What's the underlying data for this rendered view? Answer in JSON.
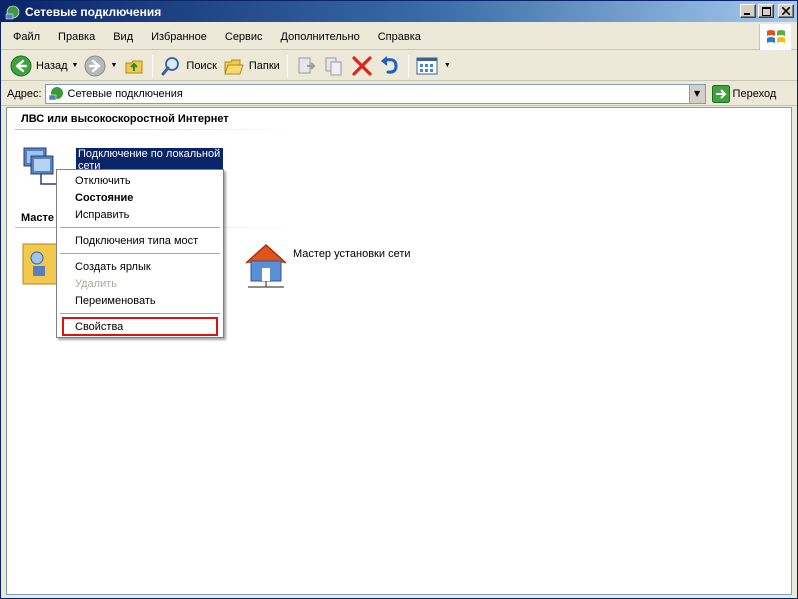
{
  "window": {
    "title": "Сетевые подключения"
  },
  "menubar": {
    "items": [
      {
        "label": "Файл"
      },
      {
        "label": "Правка"
      },
      {
        "label": "Вид"
      },
      {
        "label": "Избранное"
      },
      {
        "label": "Сервис"
      },
      {
        "label": "Дополнительно"
      },
      {
        "label": "Справка"
      }
    ]
  },
  "toolbar": {
    "back_label": "Назад",
    "search_label": "Поиск",
    "folders_label": "Папки"
  },
  "address": {
    "label": "Адрес:",
    "value": "Сетевые подключения",
    "go_label": "Переход"
  },
  "groups": {
    "lan_title": "ЛВС или высокоскоростной Интернет",
    "wizard_title": "Масте"
  },
  "items": {
    "lan_connection_label": "Подключение по локальной сети",
    "network_wizard_label": "Мастер установки сети"
  },
  "context_menu": {
    "items": [
      {
        "label": "Отключить",
        "style": "normal"
      },
      {
        "label": "Состояние",
        "style": "bold"
      },
      {
        "label": "Исправить",
        "style": "normal"
      },
      {
        "label": "Подключения типа мост",
        "style": "normal"
      },
      {
        "label": "Создать ярлык",
        "style": "normal"
      },
      {
        "label": "Удалить",
        "style": "disabled"
      },
      {
        "label": "Переименовать",
        "style": "normal"
      },
      {
        "label": "Свойства",
        "style": "normal"
      }
    ],
    "highlighted_item": "Свойства",
    "highlight_color": "#e01010"
  },
  "colors": {
    "title_blue": "#0a246a",
    "selection": "#0a246a",
    "chrome": "#ece9d8"
  }
}
